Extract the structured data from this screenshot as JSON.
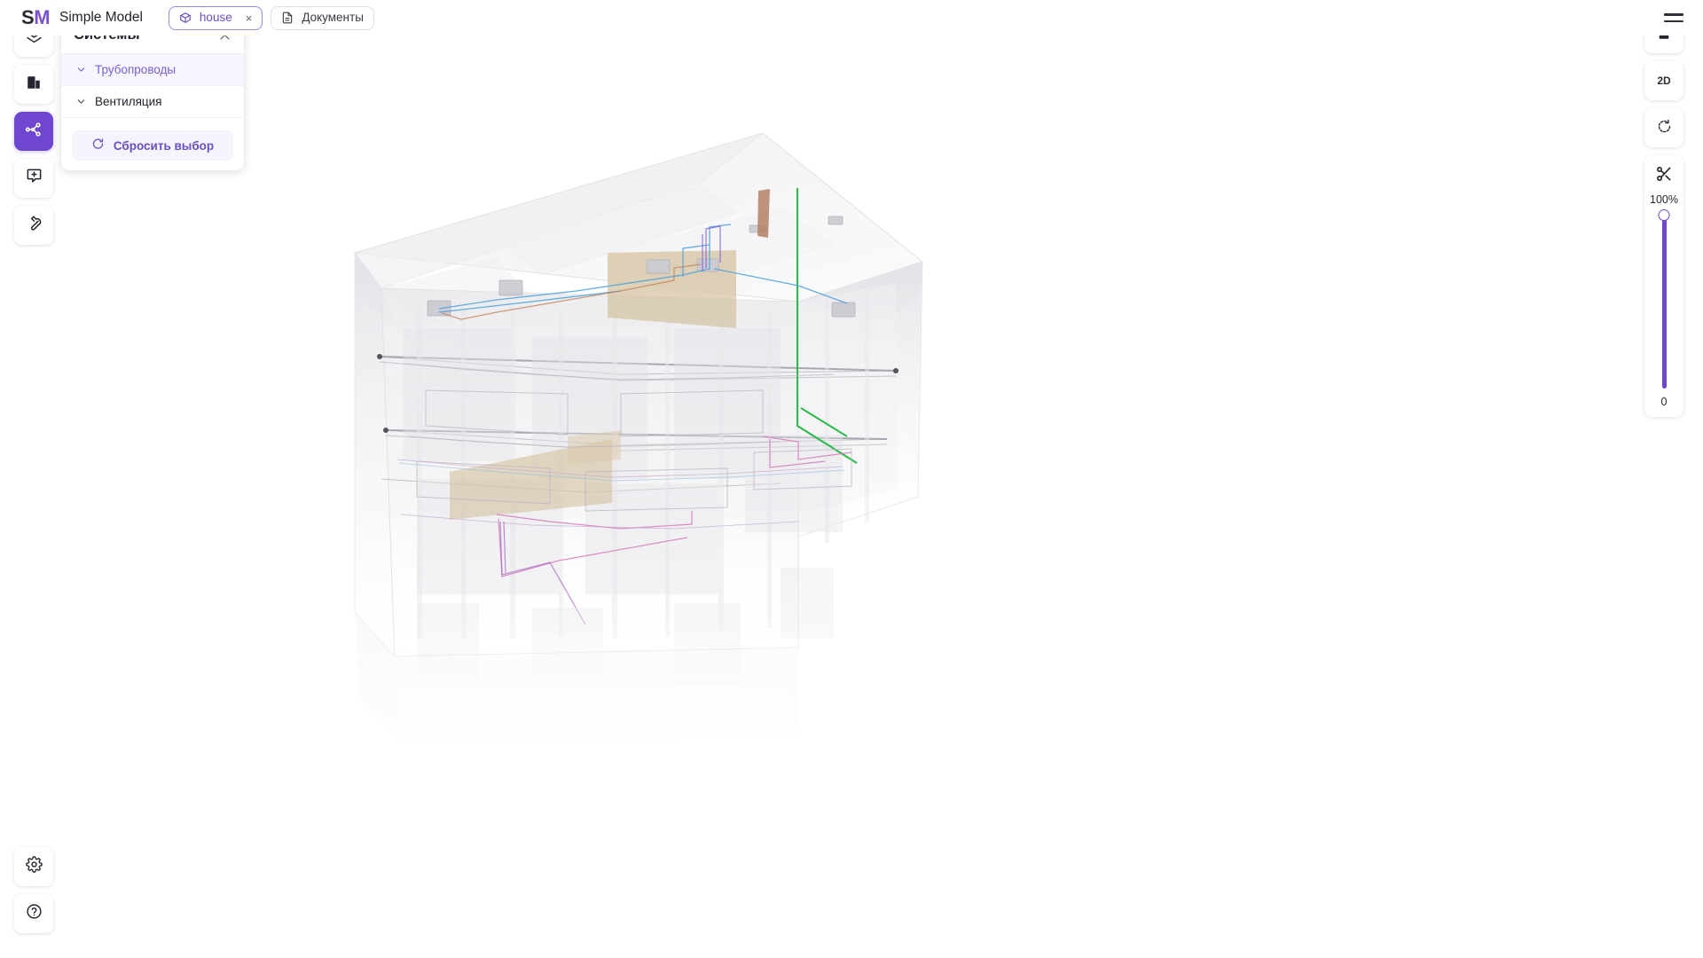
{
  "app": {
    "brand_initials_first": "S",
    "brand_initials_second": "M",
    "brand_name": "Simple Model",
    "accent_color": "#6f46cf",
    "accent_light": "#f5f3fb",
    "brand_purple": "#7a52cc"
  },
  "header": {
    "menu_icon": "hamburger-menu-icon",
    "tabs": [
      {
        "label": "house",
        "icon": "box-model-icon",
        "active": true,
        "closable": true,
        "close_glyph": "×"
      },
      {
        "label": "Документы",
        "icon": "document-icon",
        "active": false,
        "closable": false
      }
    ]
  },
  "left_rail": {
    "items": [
      {
        "name": "layers-icon",
        "label": "Слои",
        "active": false
      },
      {
        "name": "building-icon",
        "label": "Здание",
        "active": false
      },
      {
        "name": "systems-sitemap-icon",
        "label": "Системы",
        "active": true
      },
      {
        "name": "add-comment-icon",
        "label": "Комментарий",
        "active": false
      },
      {
        "name": "wrench-icon",
        "label": "Инструменты",
        "active": false
      }
    ],
    "bottom_items": [
      {
        "name": "gear-icon",
        "label": "Настройки"
      },
      {
        "name": "help-circle-icon",
        "label": "Помощь"
      }
    ]
  },
  "panel": {
    "title": "Системы",
    "close_icon": "close-icon",
    "groups": [
      {
        "label": "Трубопроводы",
        "selected": true,
        "expanded": false
      },
      {
        "label": "Вентиляция",
        "selected": false,
        "expanded": false
      }
    ],
    "reset_label": "Сбросить выбор",
    "reset_icon": "refresh-icon"
  },
  "right_tools": {
    "buttons": [
      {
        "name": "home-view-button",
        "label": "",
        "icon": "home-icon"
      },
      {
        "name": "view-2d-button",
        "label": "2D",
        "icon": "text-2d"
      },
      {
        "name": "reset-rotation-button",
        "label": "",
        "icon": "rotate-ccw-icon"
      }
    ],
    "clipping": {
      "icon": "scissors-icon",
      "max_label": "100%",
      "min_label": "0",
      "value": 100
    }
  }
}
